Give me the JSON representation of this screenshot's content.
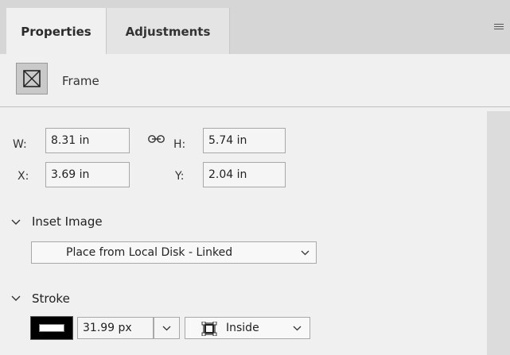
{
  "tabs": [
    {
      "label": "Properties",
      "active": true
    },
    {
      "label": "Adjustments",
      "active": false
    }
  ],
  "header": {
    "panel_menu_icon": "hamburger-icon"
  },
  "frame": {
    "label": "Frame",
    "icon": "frame-placeholder-icon"
  },
  "transform": {
    "w_label": "W:",
    "w_value": "8.31 in",
    "h_label": "H:",
    "h_value": "5.74 in",
    "x_label": "X:",
    "x_value": "3.69 in",
    "y_label": "Y:",
    "y_value": "2.04 in",
    "link_icon": "link-icon"
  },
  "inset_image": {
    "title": "Inset Image",
    "dropdown_value": "Place from Local Disk - Linked"
  },
  "stroke": {
    "title": "Stroke",
    "color": "#000000",
    "width_value": "31.99 px",
    "alignment_value": "Inside"
  }
}
